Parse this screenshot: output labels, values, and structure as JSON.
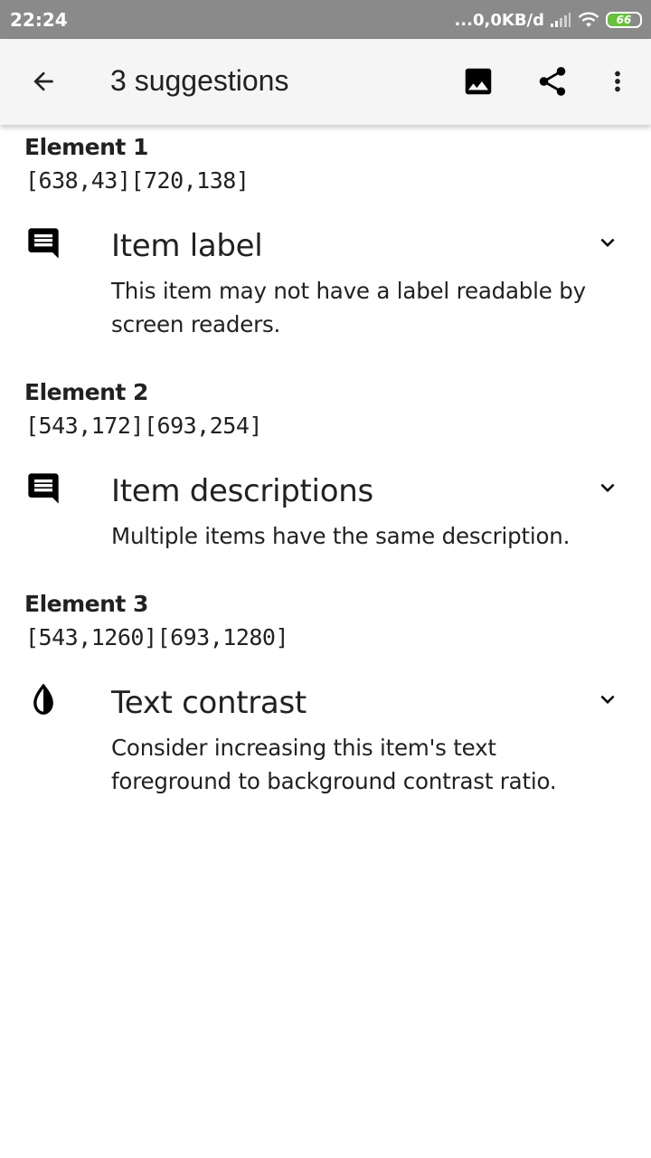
{
  "status_bar": {
    "time": "22:24",
    "network_rate": "...0,0KB/d",
    "battery_level": "66",
    "battery_fraction": 0.66,
    "battery_color": "#67c23a"
  },
  "toolbar": {
    "title": "3 suggestions",
    "icons": [
      "back-arrow-icon",
      "image-icon",
      "share-icon",
      "more-vert-icon"
    ]
  },
  "elements": [
    {
      "title": "Element 1",
      "bounds": "[638,43][720,138]",
      "issue_icon": "comment-icon",
      "issue_title": "Item label",
      "issue_desc": "This item may not have a label readable by screen readers."
    },
    {
      "title": "Element 2",
      "bounds": "[543,172][693,254]",
      "issue_icon": "comment-icon",
      "issue_title": "Item descriptions",
      "issue_desc": "Multiple items have the same description."
    },
    {
      "title": "Element 3",
      "bounds": "[543,1260][693,1280]",
      "issue_icon": "contrast-icon",
      "issue_title": "Text contrast",
      "issue_desc": "Consider increasing this item's text foreground to background contrast ratio."
    }
  ]
}
